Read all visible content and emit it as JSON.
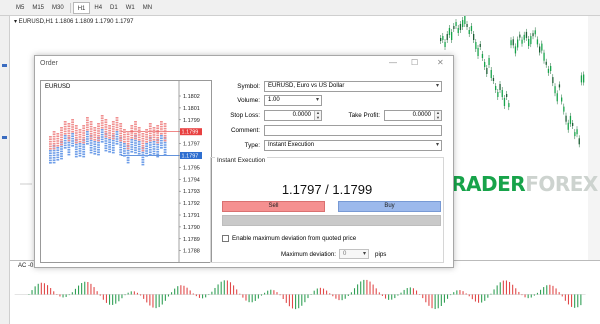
{
  "toolbar": {
    "timeframes": [
      {
        "label": "M5",
        "active": false
      },
      {
        "label": "M15",
        "active": false
      },
      {
        "label": "M30",
        "active": false
      },
      {
        "label": "H1",
        "active": true
      },
      {
        "label": "H4",
        "active": false
      },
      {
        "label": "D1",
        "active": false
      },
      {
        "label": "W1",
        "active": false
      },
      {
        "label": "MN",
        "active": false
      }
    ]
  },
  "chart": {
    "symbol_line": "▾ EURUSD,H1  1.1806 1.1809 1.1790 1.1797",
    "indicator_label": "AC -0.000294"
  },
  "order_dialog": {
    "title": "Order",
    "minimize_glyph": "—",
    "maximize_glyph": "☐",
    "close_glyph": "✕",
    "mini_chart": {
      "symbol": "EURUSD",
      "price_labels": [
        "1.1802",
        "1.1801",
        "1.1799",
        "1.1798",
        "1.1797",
        "1.1796",
        "1.1795",
        "1.1794",
        "1.1793",
        "1.1792",
        "1.1791",
        "1.1790",
        "1.1789",
        "1.1788"
      ],
      "ask_label": "1.1799",
      "bid_label": "1.1797",
      "ask_color": "#e84040",
      "bid_color": "#2f6fd0"
    },
    "form": {
      "symbol_label": "Symbol:",
      "symbol_value": "EURUSD, Euro vs US Dollar",
      "volume_label": "Volume:",
      "volume_value": "1.00",
      "stop_loss_label": "Stop Loss:",
      "stop_loss_value": "0.0000",
      "take_profit_label": "Take Profit:",
      "take_profit_value": "0.0000",
      "comment_label": "Comment:",
      "comment_value": "",
      "type_label": "Type:",
      "type_value": "Instant Execution"
    },
    "execution": {
      "group_title": "Instant Execution",
      "quote": "1.1797 / 1.1799",
      "sell_label": "Sell",
      "buy_label": "Buy",
      "max_deviation_checkbox_label": "Enable maximum deviation from quoted price",
      "max_deviation_checked": false,
      "max_deviation_label": "Maximum deviation:",
      "max_deviation_value": "0",
      "pips_label": "pips"
    }
  },
  "watermark": {
    "part1": "TRADER",
    "part2": "FOREX"
  },
  "colors": {
    "sell": "#f59090",
    "buy": "#9cb9ec",
    "bull_candle": "#17a34a",
    "bear_candle": "#2e7d44",
    "ac_up": "#2e9e53",
    "ac_down": "#e04848"
  }
}
